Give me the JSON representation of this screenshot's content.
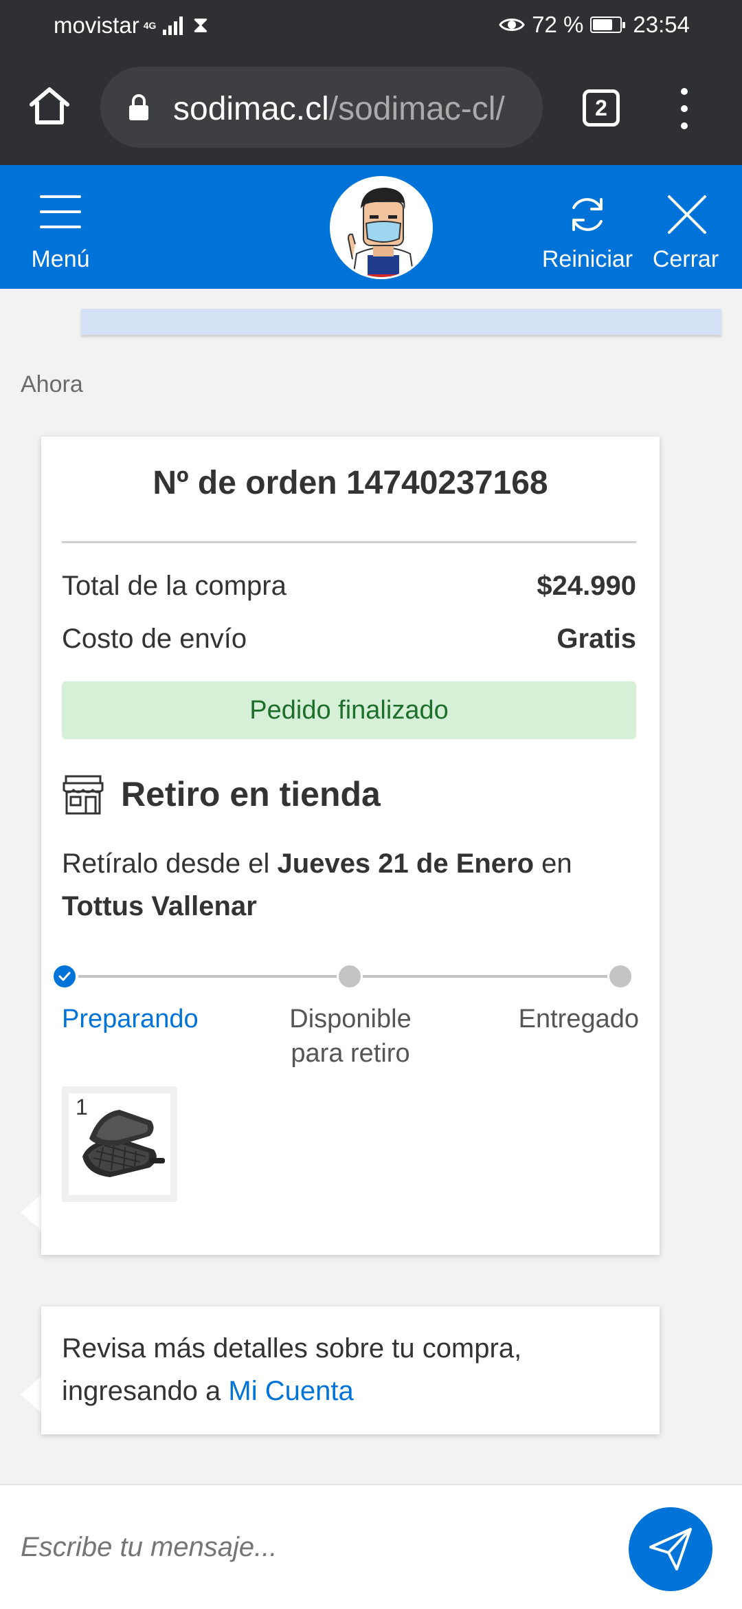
{
  "status_bar": {
    "carrier": "movistar",
    "network": "4G",
    "battery_percent": "72 %",
    "battery_level": 0.72,
    "time": "23:54"
  },
  "browser": {
    "url_domain": "sodimac.cl",
    "url_path": "/sodimac-cl/",
    "tab_count": "2"
  },
  "app_header": {
    "menu_label": "Menú",
    "restart_label": "Reiniciar",
    "close_label": "Cerrar",
    "brand_color": "#0073d8"
  },
  "chat": {
    "timestamp": "Ahora",
    "order_card": {
      "title": "Nº de orden 14740237168",
      "rows": [
        {
          "label": "Total de la compra",
          "value": "$24.990"
        },
        {
          "label": "Costo de envío",
          "value": "Gratis"
        }
      ],
      "status": "Pedido finalizado",
      "pickup_title": "Retiro en tienda",
      "pickup_pre": "Retíralo desde el ",
      "pickup_date": "Jueves 21 de Enero",
      "pickup_mid": " en",
      "pickup_store": "Tottus Vallenar",
      "steps": [
        {
          "label": "Preparando",
          "done": true
        },
        {
          "label": "Disponible para retiro",
          "label_l1": "Disponible",
          "label_l2": "para retiro",
          "done": false
        },
        {
          "label": "Entregado",
          "done": false
        }
      ],
      "product_qty": "1",
      "product_icon": "waffle-maker-image"
    },
    "info_card": {
      "text_pre": "Revisa más detalles sobre tu compra, ingresando a ",
      "link": "Mi Cuenta"
    }
  },
  "composer": {
    "placeholder": "Escribe tu mensaje..."
  }
}
